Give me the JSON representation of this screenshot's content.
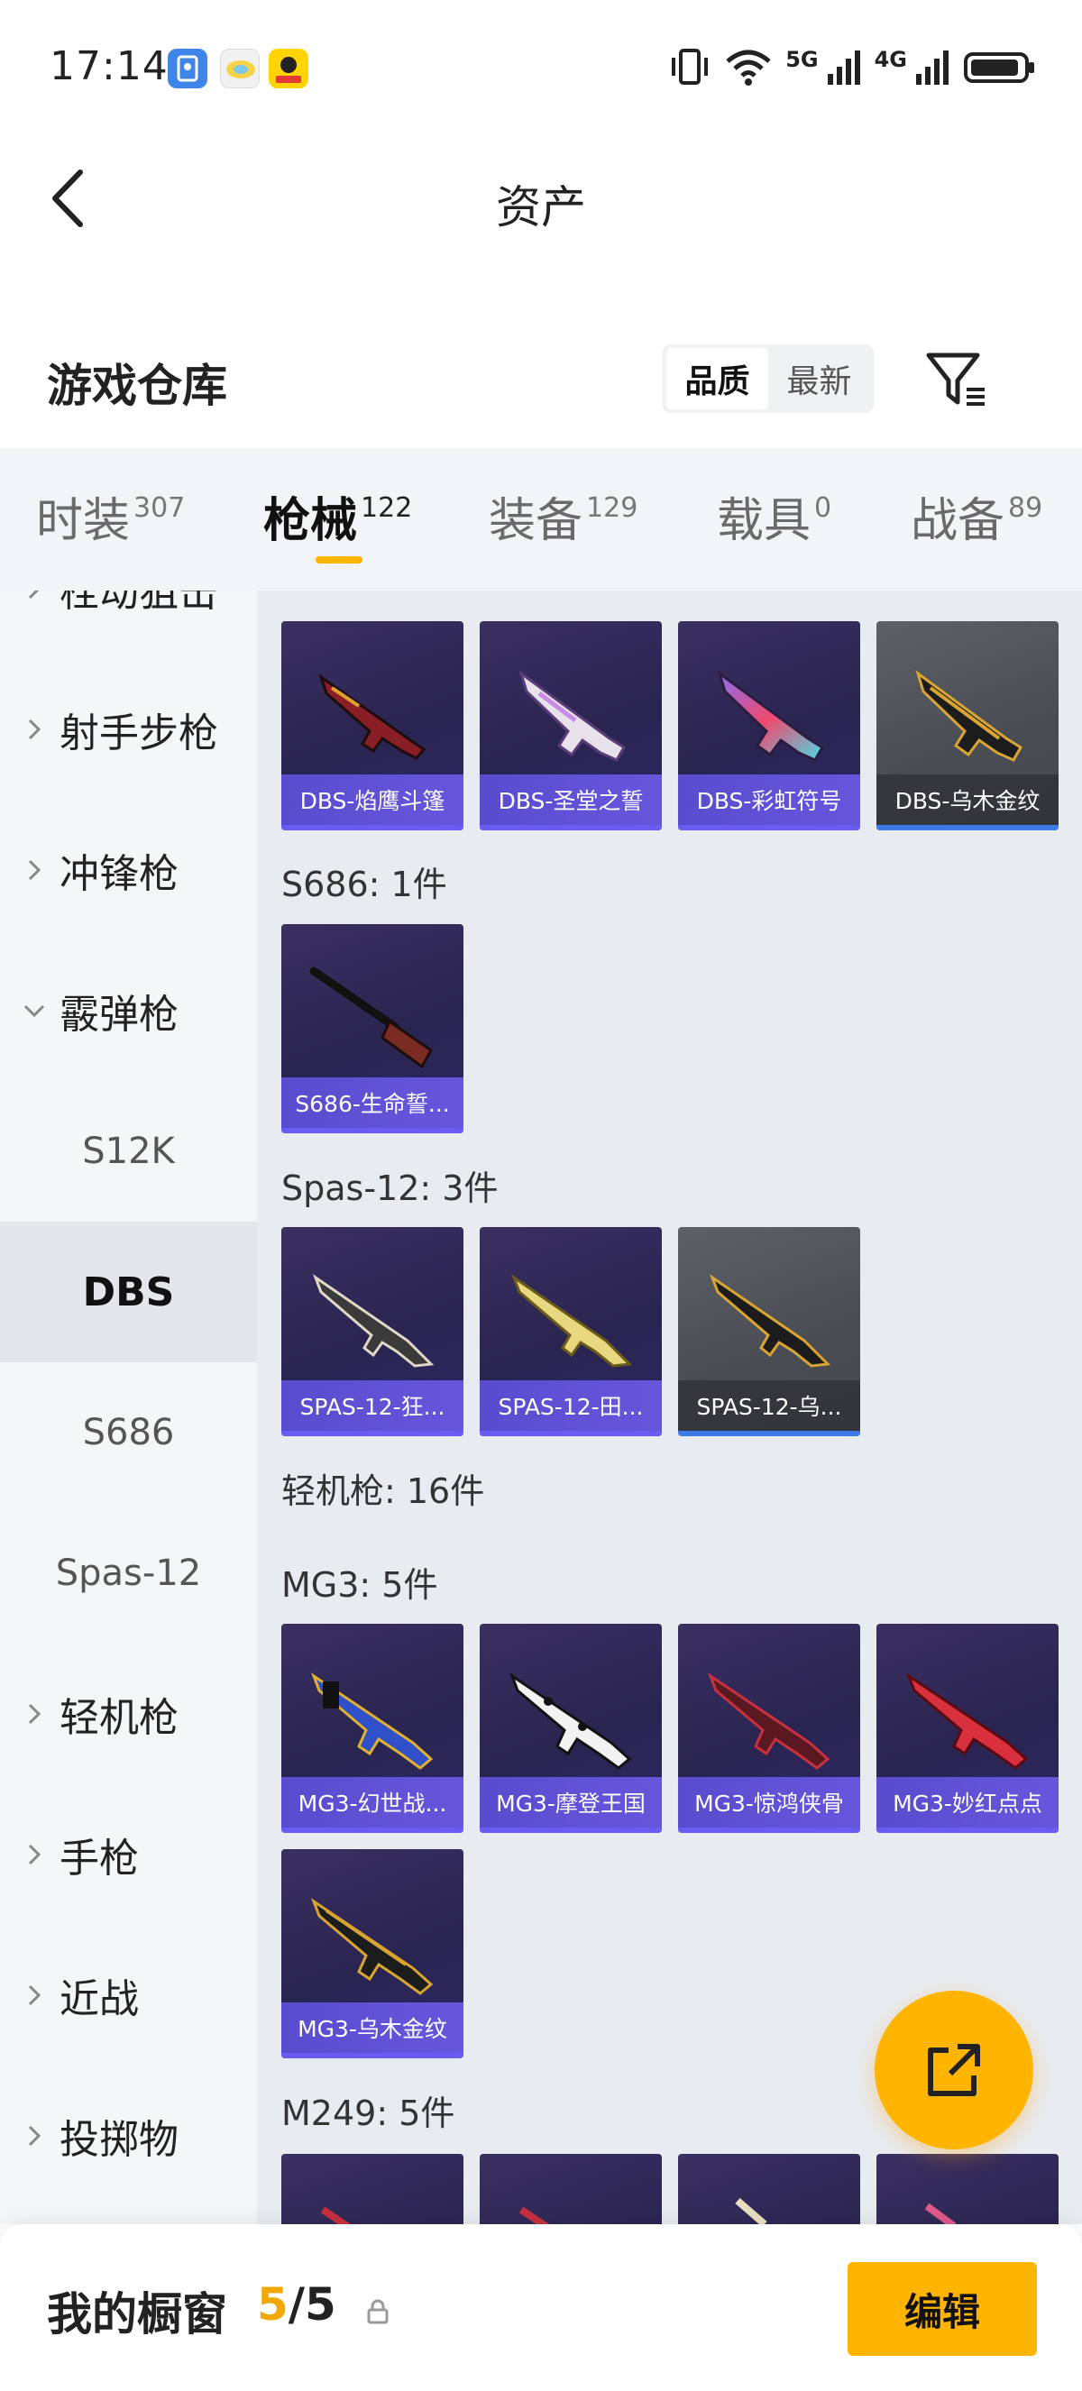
{
  "status_bar": {
    "time": "17:14",
    "network_1": "5G",
    "network_2": "4G",
    "icons": [
      "vibrate-icon",
      "wifi-icon",
      "signal-icon",
      "signal-icon",
      "battery-icon"
    ]
  },
  "nav": {
    "title": "资产"
  },
  "warehouse": {
    "title": "游戏仓库",
    "sort_options": [
      "品质",
      "最新"
    ],
    "sort_selected": "品质"
  },
  "tabs": [
    {
      "label": "时装",
      "count": "307"
    },
    {
      "label": "枪械",
      "count": "122",
      "active": true
    },
    {
      "label": "装备",
      "count": "129"
    },
    {
      "label": "载具",
      "count": "0"
    },
    {
      "label": "战备",
      "count": "89"
    }
  ],
  "sidebar": {
    "items": [
      {
        "label": "栓动狙击",
        "expanded": false
      },
      {
        "label": "射手步枪",
        "expanded": false
      },
      {
        "label": "冲锋枪",
        "expanded": false
      },
      {
        "label": "霰弹枪",
        "expanded": true
      },
      {
        "label": "S12K",
        "sub": true
      },
      {
        "label": "DBS",
        "sub": true,
        "active": true
      },
      {
        "label": "S686",
        "sub": true
      },
      {
        "label": "Spas-12",
        "sub": true
      },
      {
        "label": "轻机枪",
        "expanded": false
      },
      {
        "label": "手枪",
        "expanded": false
      },
      {
        "label": "近战",
        "expanded": false
      },
      {
        "label": "投掷物",
        "expanded": false
      }
    ]
  },
  "main": {
    "groups": [
      {
        "title": "",
        "items": [
          {
            "name": "DBS-焰鹰斗篷",
            "tier": "purple"
          },
          {
            "name": "DBS-圣堂之誓",
            "tier": "purple"
          },
          {
            "name": "DBS-彩虹符号",
            "tier": "purple"
          },
          {
            "name": "DBS-乌木金纹",
            "tier": "gray"
          }
        ]
      },
      {
        "title": "S686: 1件",
        "items": [
          {
            "name": "S686-生命誓...",
            "tier": "purple"
          }
        ]
      },
      {
        "title": "Spas-12: 3件",
        "items": [
          {
            "name": "SPAS-12-狂...",
            "tier": "purple"
          },
          {
            "name": "SPAS-12-田...",
            "tier": "purple"
          },
          {
            "name": "SPAS-12-乌...",
            "tier": "gray"
          }
        ]
      },
      {
        "title": "轻机枪: 16件",
        "items": []
      },
      {
        "title": "MG3: 5件",
        "items": [
          {
            "name": "MG3-幻世战...",
            "tier": "purple"
          },
          {
            "name": "MG3-摩登王国",
            "tier": "purple"
          },
          {
            "name": "MG3-惊鸿侠骨",
            "tier": "purple"
          },
          {
            "name": "MG3-妙红点点",
            "tier": "purple"
          },
          {
            "name": "MG3-乌木金纹",
            "tier": "purple"
          }
        ]
      },
      {
        "title": "M249: 5件",
        "items": []
      }
    ]
  },
  "bottom": {
    "title": "我的橱窗",
    "count_current": "5",
    "count_total": "/5",
    "edit_label": "编辑"
  },
  "colors": {
    "accent": "#ffb400",
    "purple_card": "#2a2450",
    "purple_strip": "#5a4cce",
    "gray_card": "#4a4c54"
  }
}
